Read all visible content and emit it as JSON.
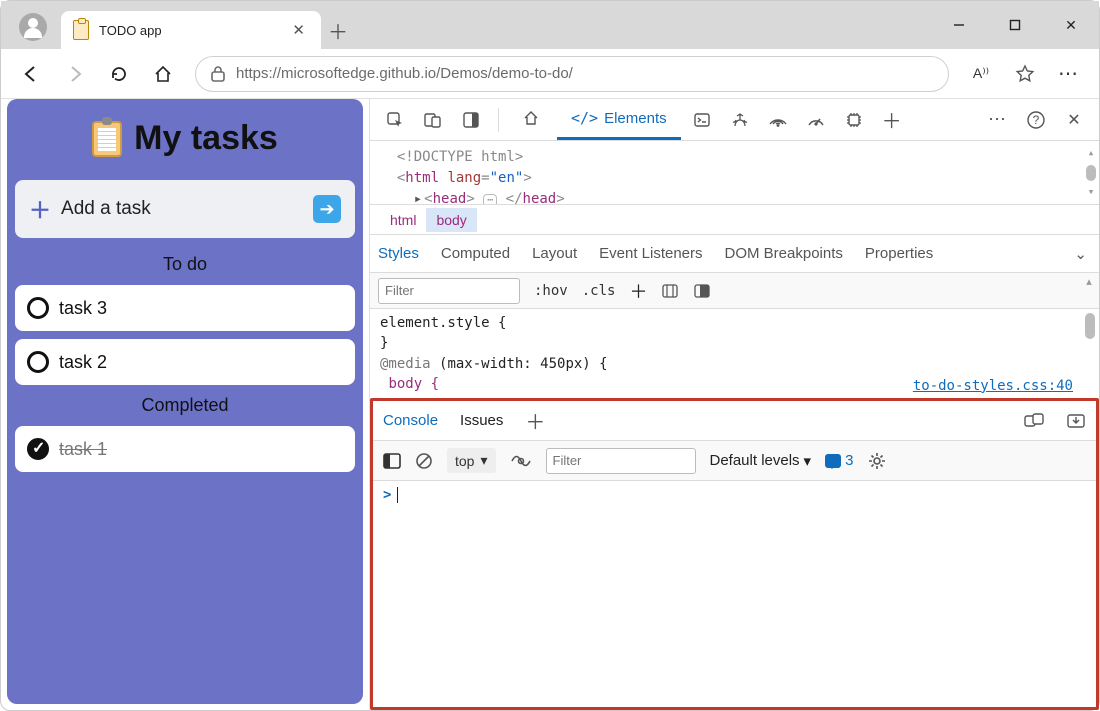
{
  "window": {
    "tab_title": "TODO app"
  },
  "address": {
    "url": "https://microsoftedge.github.io/Demos/demo-to-do/"
  },
  "app": {
    "title": "My tasks",
    "add_label": "Add a task",
    "section_todo": "To do",
    "section_done": "Completed",
    "tasks_todo": [
      "task 3",
      "task 2"
    ],
    "tasks_done": [
      "task 1"
    ]
  },
  "devtools": {
    "main_tab": "Elements",
    "dom": {
      "line1": "<!DOCTYPE html>",
      "html_tag": "html",
      "html_attr": "lang",
      "html_val": "\"en\"",
      "head_tag": "head"
    },
    "crumbs": [
      "html",
      "body"
    ],
    "sub_tabs": [
      "Styles",
      "Computed",
      "Layout",
      "Event Listeners",
      "DOM Breakpoints",
      "Properties"
    ],
    "styles_filter_ph": "Filter",
    "hov": ":hov",
    "cls": ".cls",
    "css": {
      "l1": "element.style {",
      "l2": "}",
      "l3a": "@media",
      "l3b": "(max-width: 450px) {",
      "l4": "body {",
      "link": "to-do-styles.css:40"
    },
    "drawer_tabs": [
      "Console",
      "Issues"
    ],
    "console": {
      "context": "top",
      "filter_ph": "Filter",
      "levels": "Default levels",
      "issue_count": "3"
    }
  }
}
